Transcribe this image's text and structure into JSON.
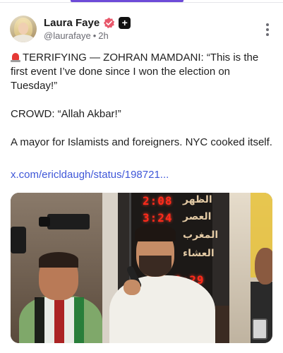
{
  "post": {
    "author": {
      "display_name": "Laura Faye",
      "handle": "@laurafaye",
      "time_ago": "2h",
      "avatar_icon": "avatar-photo",
      "verified_icon": "verified-badge-icon",
      "plus_icon": "plus-badge-icon"
    },
    "paragraphs": [
      "TERRIFYING — ZOHRAN MAMDANI: “This is the first event I’ve done since I won the election on Tuesday!”",
      "CROWD: “Allah Akbar!”",
      "A mayor for Islamists and foreigners. NYC cooked itself."
    ],
    "siren_icon": "rotating-light-icon",
    "link_text": "x.com/ericldaugh/status/198721...",
    "media": {
      "type": "video-still",
      "led_times": [
        "2:08",
        "3:24",
        "8:29"
      ],
      "arabic_labels": [
        "الظهر",
        "العصر",
        "المغرب",
        "العشاء"
      ]
    }
  },
  "colors": {
    "accent": "#6d4bd8",
    "link": "#3f57d8",
    "verified": "#e8586b",
    "meta": "#6b6b73"
  }
}
